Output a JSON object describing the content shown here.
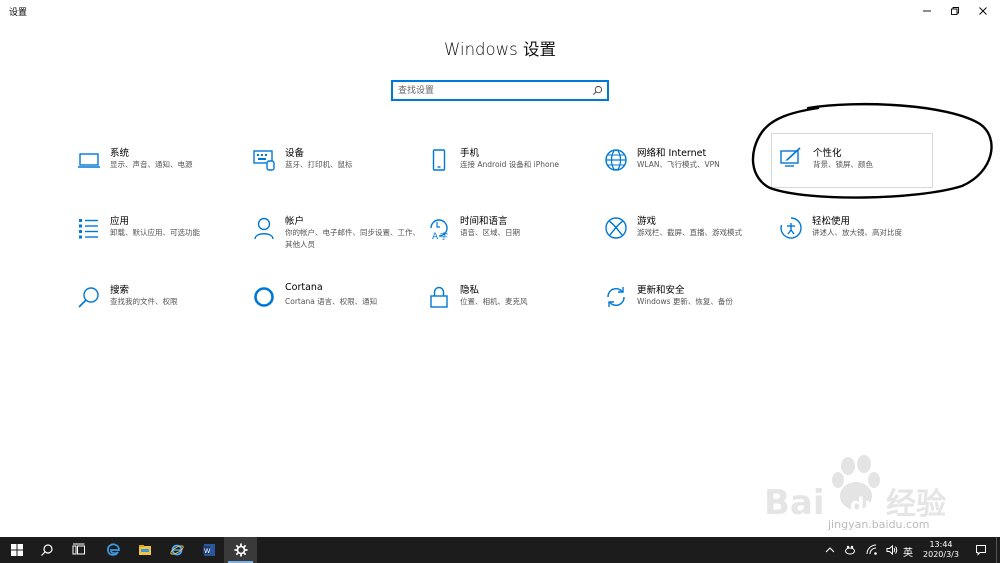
{
  "window": {
    "title": "设置",
    "controls": [
      "minimize",
      "maximize",
      "close"
    ]
  },
  "page": {
    "title": "Windows 设置"
  },
  "search": {
    "placeholder": "查找设置",
    "value": ""
  },
  "categories": [
    {
      "id": "system",
      "name": "系统",
      "desc": "显示、声音、通知、电源",
      "icon": "laptop-icon"
    },
    {
      "id": "devices",
      "name": "设备",
      "desc": "蓝牙、打印机、鼠标",
      "icon": "keyboard-icon"
    },
    {
      "id": "phone",
      "name": "手机",
      "desc": "连接 Android 设备和 iPhone",
      "icon": "phone-icon"
    },
    {
      "id": "network",
      "name": "网络和 Internet",
      "desc": "WLAN、飞行模式、VPN",
      "icon": "globe-icon"
    },
    {
      "id": "personalization",
      "name": "个性化",
      "desc": "背景、锁屏、颜色",
      "icon": "personalize-icon"
    },
    {
      "id": "apps",
      "name": "应用",
      "desc": "卸载、默认应用、可选功能",
      "icon": "apps-list-icon"
    },
    {
      "id": "accounts",
      "name": "帐户",
      "desc": "你的帐户、电子邮件、同步设置、工作、其他人员",
      "icon": "person-icon"
    },
    {
      "id": "time-language",
      "name": "时间和语言",
      "desc": "语音、区域、日期",
      "icon": "time-language-icon"
    },
    {
      "id": "gaming",
      "name": "游戏",
      "desc": "游戏栏、截屏、直播、游戏模式",
      "icon": "xbox-icon"
    },
    {
      "id": "ease-of-access",
      "name": "轻松使用",
      "desc": "讲述人、放大镜、高对比度",
      "icon": "ease-of-access-icon"
    },
    {
      "id": "search",
      "name": "搜索",
      "desc": "查找我的文件、权限",
      "icon": "search-icon"
    },
    {
      "id": "cortana",
      "name": "Cortana",
      "desc": "Cortana 语言、权限、通知",
      "icon": "cortana-icon"
    },
    {
      "id": "privacy",
      "name": "隐私",
      "desc": "位置、相机、麦克风",
      "icon": "lock-icon"
    },
    {
      "id": "update-security",
      "name": "更新和安全",
      "desc": "Windows 更新、恢复、备份",
      "icon": "sync-icon"
    }
  ],
  "taskbar": {
    "apps": [
      "start-icon",
      "search-icon",
      "task-view-icon",
      "edge-icon",
      "file-explorer-icon",
      "internet-explorer-icon",
      "word-icon",
      "settings-icon"
    ],
    "ime": "英",
    "time": "13:44",
    "date": "2020/3/3"
  },
  "colors": {
    "accent": "#0078d7",
    "taskbar": "#1c1c1c",
    "annotation": "#000000"
  },
  "watermark": {
    "logo": "Baidu经验",
    "url": "jingyan.baidu.com"
  }
}
